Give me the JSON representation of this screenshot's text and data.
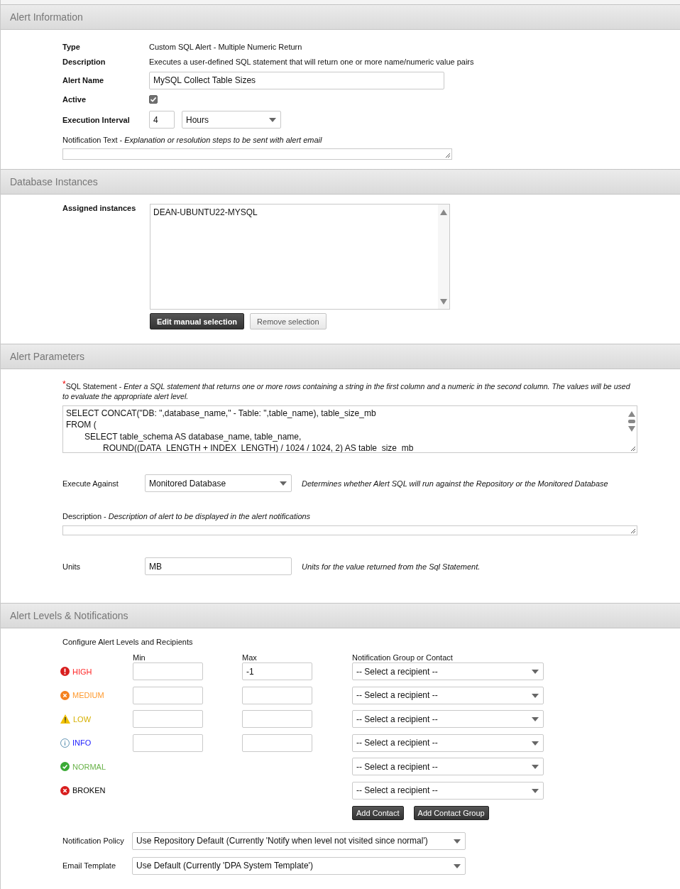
{
  "alert_information": {
    "title": "Alert Information",
    "type": {
      "label": "Type",
      "value": "Custom SQL Alert - Multiple Numeric Return"
    },
    "description": {
      "label": "Description",
      "value": "Executes a user-defined SQL statement that will return one or more name/numeric value pairs"
    },
    "alert_name": {
      "label": "Alert Name",
      "value": "MySQL Collect Table Sizes"
    },
    "active": {
      "label": "Active",
      "checked": true
    },
    "execution_interval": {
      "label": "Execution Interval",
      "value": "4",
      "unit": "Hours"
    },
    "notification_text": {
      "label": "Notification Text -",
      "hint": "Explanation or resolution steps to be sent with alert email"
    }
  },
  "database_instances": {
    "title": "Database Instances",
    "label": "Assigned instances",
    "instances": [
      "DEAN-UBUNTU22-MYSQL"
    ],
    "buttons": [
      {
        "label": "Edit manual selection",
        "kind": "primary"
      },
      {
        "label": "Remove selection",
        "kind": "secondary"
      }
    ]
  },
  "alert_parameters": {
    "title": "Alert Parameters",
    "sql_statement": {
      "required_mark": "*",
      "label": "SQL Statement -",
      "hint": "Enter a SQL statement that returns one or more rows containing a string in the first column and a numeric in the second column. The values will be used to evaluate the appropriate alert level.",
      "value": "SELECT CONCAT(\"DB: \",database_name,\" - Table: \",table_name), table_size_mb\nFROM (\n\tSELECT table_schema AS database_name, table_name,\n\t\tROUND((DATA_LENGTH + INDEX_LENGTH) / 1024 / 1024, 2) AS table_size_mb"
    },
    "execute_against": {
      "label": "Execute Against",
      "value": "Monitored Database",
      "hint": "Determines whether Alert SQL will run against the Repository or the Monitored Database"
    },
    "description": {
      "label": "Description -",
      "hint": "Description of alert to be displayed in the alert notifications"
    },
    "units": {
      "label": "Units",
      "value": "MB",
      "hint": "Units for the value returned from the Sql Statement."
    }
  },
  "alert_levels": {
    "title": "Alert Levels & Notifications",
    "heading": "Configure Alert Levels and Recipients",
    "columns": [
      "Min",
      "Max",
      "Notification Group or Contact"
    ],
    "levels": [
      {
        "name": "HIGH",
        "kind": "high",
        "color": "#ff2a2a",
        "thresholds": true,
        "max": "-1",
        "recipient": "-- Select a recipient --"
      },
      {
        "name": "MEDIUM",
        "kind": "medium",
        "color": "#ff9a2e",
        "thresholds": true,
        "recipient": "-- Select a recipient --"
      },
      {
        "name": "LOW",
        "kind": "low",
        "color": "#d6b000",
        "thresholds": true,
        "recipient": "-- Select a recipient --"
      },
      {
        "name": "INFO",
        "kind": "info",
        "color": "#2222ff",
        "thresholds": true,
        "recipient": "-- Select a recipient --"
      },
      {
        "name": "NORMAL",
        "kind": "normal",
        "color": "#6ab34a",
        "thresholds": false,
        "recipient": "-- Select a recipient --"
      },
      {
        "name": "BROKEN",
        "kind": "broken",
        "color": "#000000",
        "thresholds": false,
        "recipient": "-- Select a recipient --"
      }
    ],
    "buttons": [
      "Add Contact",
      "Add Contact Group"
    ],
    "notification_policy": {
      "label": "Notification Policy",
      "value": "Use Repository Default (Currently 'Notify when level not visited since normal')"
    },
    "email_template": {
      "label": "Email Template",
      "value": "Use Default (Currently 'DPA System Template')"
    }
  }
}
